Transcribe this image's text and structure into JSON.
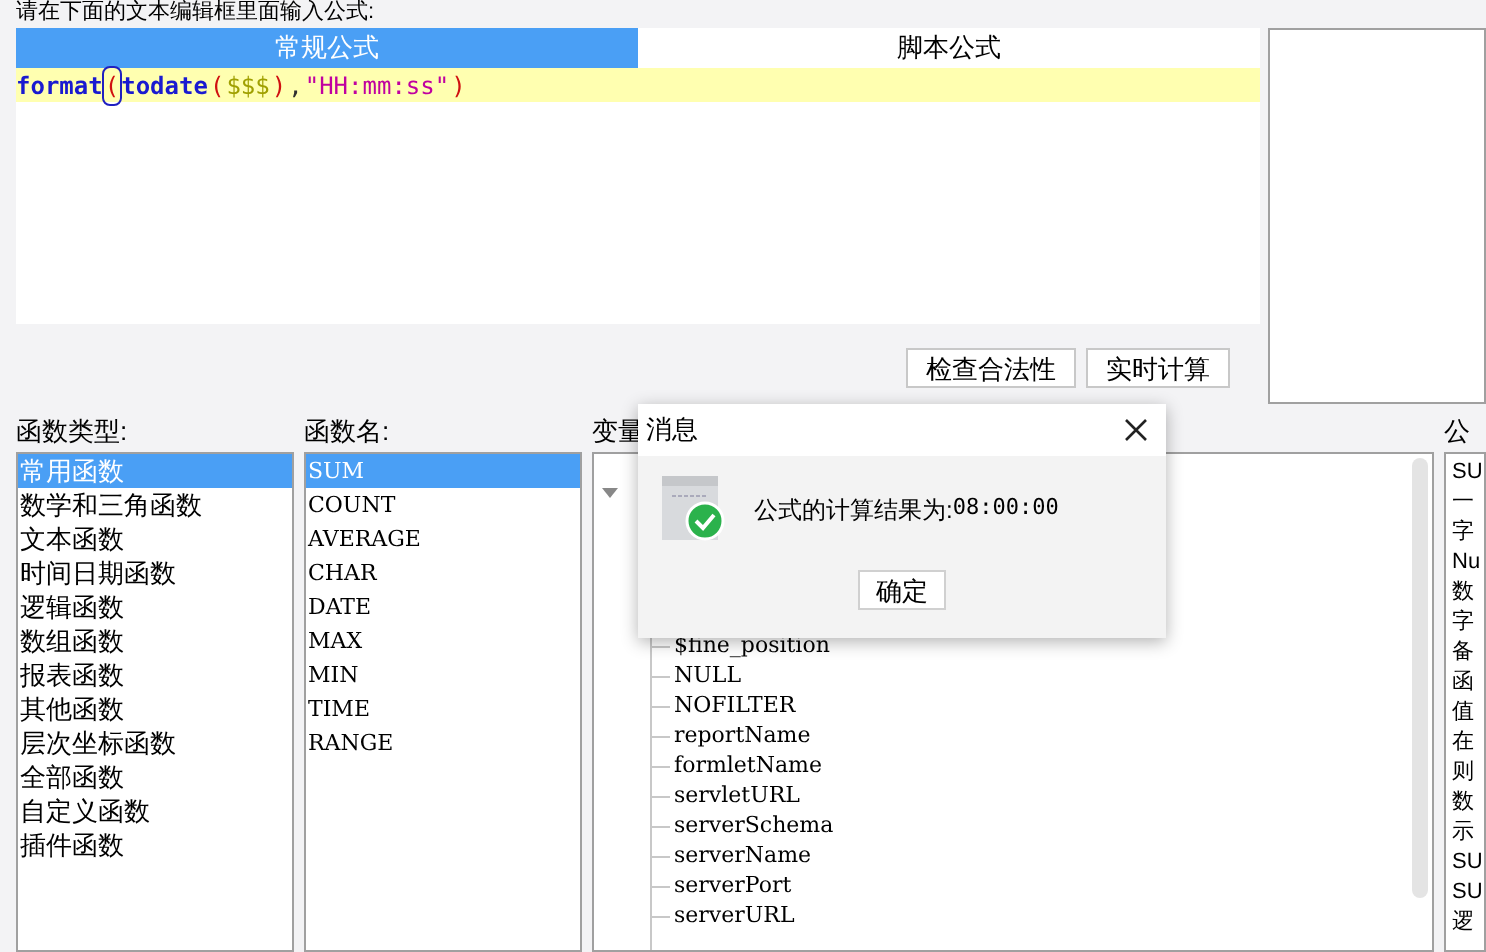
{
  "prompt": "请在下面的文本编辑框里面输入公式:",
  "tabs": [
    {
      "label": "常规公式",
      "selected": true
    },
    {
      "label": "脚本公式",
      "selected": false
    }
  ],
  "formula_tokens": [
    {
      "text": "format",
      "kind": "function"
    },
    {
      "text": "(",
      "kind": "paren",
      "cursor": true
    },
    {
      "text": "todate",
      "kind": "function"
    },
    {
      "text": "(",
      "kind": "paren"
    },
    {
      "text": "$$$",
      "kind": "variable"
    },
    {
      "text": ")",
      "kind": "paren"
    },
    {
      "text": ",",
      "kind": "plain"
    },
    {
      "text": "\"HH:mm:ss\"",
      "kind": "string"
    },
    {
      "text": ")",
      "kind": "paren"
    }
  ],
  "buttons": [
    "检查合法性",
    "实时计算"
  ],
  "function_types": {
    "label": "函数类型:",
    "items": [
      {
        "label": "常用函数",
        "selected": true
      },
      {
        "label": "数学和三角函数",
        "selected": false
      },
      {
        "label": "文本函数",
        "selected": false
      },
      {
        "label": "时间日期函数",
        "selected": false
      },
      {
        "label": "逻辑函数",
        "selected": false
      },
      {
        "label": "数组函数",
        "selected": false
      },
      {
        "label": "报表函数",
        "selected": false
      },
      {
        "label": "其他函数",
        "selected": false
      },
      {
        "label": "层次坐标函数",
        "selected": false
      },
      {
        "label": "全部函数",
        "selected": false
      },
      {
        "label": "自定义函数",
        "selected": false
      },
      {
        "label": "插件函数",
        "selected": false
      }
    ]
  },
  "function_names": {
    "label": "函数名:",
    "items": [
      {
        "label": "SUM",
        "selected": true
      },
      {
        "label": "COUNT",
        "selected": false
      },
      {
        "label": "AVERAGE",
        "selected": false
      },
      {
        "label": "CHAR",
        "selected": false
      },
      {
        "label": "DATE",
        "selected": false
      },
      {
        "label": "MAX",
        "selected": false
      },
      {
        "label": "MIN",
        "selected": false
      },
      {
        "label": "TIME",
        "selected": false
      },
      {
        "label": "RANGE",
        "selected": false
      }
    ]
  },
  "variables": {
    "label": "变量",
    "items": [
      "$fine_position",
      "NULL",
      "NOFILTER",
      "reportName",
      "formletName",
      "servletURL",
      "serverSchema",
      "serverName",
      "serverPort",
      "serverURL"
    ]
  },
  "description": {
    "label": "公",
    "lines": [
      "SU",
      "一",
      "字",
      "Nu",
      "数",
      "字",
      "备",
      "函",
      "值",
      "在",
      "则",
      "数",
      "示",
      "SU",
      "SU",
      "逻"
    ]
  },
  "dialog": {
    "title": "消息",
    "message": "公式的计算结果为:",
    "result": "08:00:00",
    "button": "确定"
  }
}
